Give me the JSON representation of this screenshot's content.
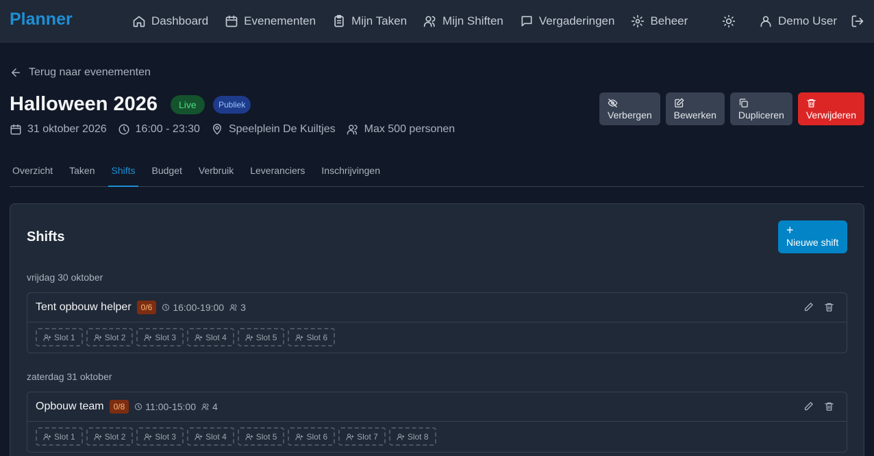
{
  "app": {
    "brand": "Planner"
  },
  "nav": [
    {
      "label": "Dashboard",
      "icon": "home-icon"
    },
    {
      "label": "Evenementen",
      "icon": "calendar-icon"
    },
    {
      "label": "Mijn Taken",
      "icon": "clipboard-icon"
    },
    {
      "label": "Mijn Shiften",
      "icon": "users-icon"
    },
    {
      "label": "Vergaderingen",
      "icon": "message-icon"
    },
    {
      "label": "Beheer",
      "icon": "gear-icon"
    }
  ],
  "user": {
    "name": "Demo User"
  },
  "back_link": "Terug naar evenementen",
  "event": {
    "title": "Halloween 2026",
    "status": "Live",
    "visibility": "Publiek",
    "date": "31 oktober 2026",
    "time": "16:00 - 23:30",
    "location": "Speelplein De Kuiltjes",
    "capacity": "Max 500 personen"
  },
  "actions": {
    "hide": "Verbergen",
    "edit": "Bewerken",
    "duplicate": "Dupliceren",
    "delete": "Verwijderen"
  },
  "tabs": [
    "Overzicht",
    "Taken",
    "Shifts",
    "Budget",
    "Verbruik",
    "Leveranciers",
    "Inschrijvingen"
  ],
  "active_tab": "Shifts",
  "shifts_section": {
    "title": "Shifts",
    "new_button": "Nieuwe shift",
    "days": [
      {
        "label": "vrijdag 30 oktober",
        "shifts": [
          {
            "name": "Tent opbouw helper",
            "filled": "0/6",
            "time": "16:00-19:00",
            "people": "3",
            "slots": [
              "Slot 1",
              "Slot 2",
              "Slot 3",
              "Slot 4",
              "Slot 5",
              "Slot 6"
            ]
          }
        ]
      },
      {
        "label": "zaterdag 31 oktober",
        "shifts": [
          {
            "name": "Opbouw team",
            "filled": "0/8",
            "time": "11:00-15:00",
            "people": "4",
            "slots": [
              "Slot 1",
              "Slot 2",
              "Slot 3",
              "Slot 4",
              "Slot 5",
              "Slot 6",
              "Slot 7",
              "Slot 8"
            ]
          }
        ]
      }
    ]
  },
  "colors": {
    "accent": "#1e8fd6",
    "live_bg": "#14532d",
    "live_text": "#4ade80",
    "danger": "#dc2626",
    "count_bg": "#7c2d12"
  }
}
